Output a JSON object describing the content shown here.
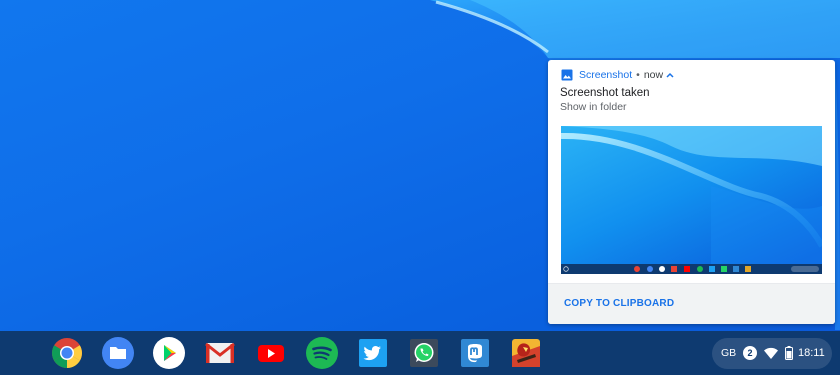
{
  "notification": {
    "app_name": "Screenshot",
    "separator": "•",
    "time": "now",
    "title": "Screenshot taken",
    "subtitle": "Show in folder",
    "action_label": "COPY TO CLIPBOARD",
    "header_icon": "image-icon",
    "expand_icon": "chevron-up-icon"
  },
  "shelf": {
    "apps": [
      {
        "name": "chrome",
        "icon": "chrome-icon"
      },
      {
        "name": "files",
        "icon": "folder-icon"
      },
      {
        "name": "play-store",
        "icon": "play-store-icon"
      },
      {
        "name": "gmail",
        "icon": "gmail-icon"
      },
      {
        "name": "youtube",
        "icon": "youtube-icon"
      },
      {
        "name": "spotify",
        "icon": "spotify-icon"
      },
      {
        "name": "twitter",
        "icon": "twitter-icon"
      },
      {
        "name": "whatsapp",
        "icon": "whatsapp-icon"
      },
      {
        "name": "mastodon",
        "icon": "mastodon-icon"
      },
      {
        "name": "game",
        "icon": "game-icon"
      }
    ]
  },
  "tray": {
    "ime": "GB",
    "notification_count": "2",
    "time": "18:11",
    "wifi_icon": "wifi-icon",
    "battery_icon": "battery-icon"
  },
  "colors": {
    "accent": "#1a73e8",
    "shelf": "#0e3a70",
    "wallpaper": "#0f6ee9"
  }
}
